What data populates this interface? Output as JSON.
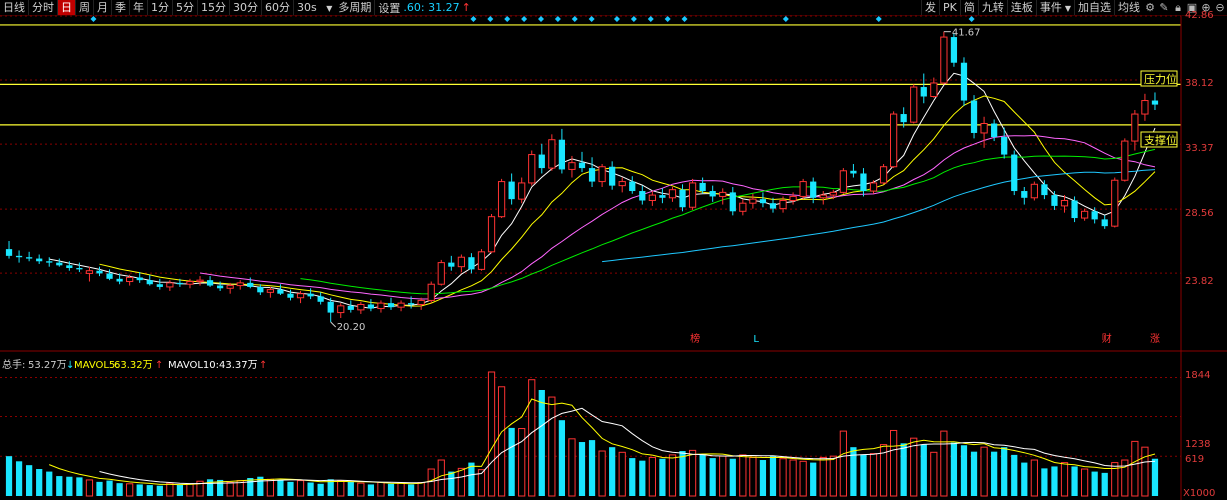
{
  "toolbar": {
    "items": [
      {
        "label": "日线",
        "active": false
      },
      {
        "label": "分时",
        "active": false
      },
      {
        "label": "日",
        "active": true
      },
      {
        "label": "周",
        "active": false
      },
      {
        "label": "月",
        "active": false
      },
      {
        "label": "季",
        "active": false
      },
      {
        "label": "年",
        "active": false
      },
      {
        "label": "1分",
        "active": false
      },
      {
        "label": "5分",
        "active": false
      },
      {
        "label": "15分",
        "active": false
      },
      {
        "label": "30分",
        "active": false
      },
      {
        "label": "60分",
        "active": false
      }
    ],
    "dropdown": "30s",
    "dropdown_arrow": "▼",
    "multi_period": "多周期",
    "settings": "设置",
    "readout": ".60: 31.27",
    "readout_arrow": "↑",
    "right_items": [
      "发",
      "PK",
      "简",
      "九转",
      "连板",
      "事件"
    ],
    "right_menu_arrow": "▼",
    "right_items2": [
      "加自选",
      "均线"
    ],
    "icons": [
      "gear-icon",
      "paint-icon",
      "lock-icon",
      "image-icon",
      "zoom-in-icon",
      "zoom-out-icon"
    ]
  },
  "colors": {
    "up": "#ff3333",
    "down": "#19e6ff",
    "ma5": "#ffffff",
    "ma10": "#ffff00",
    "ma20": "#ff66ff",
    "ma30": "#00ee00",
    "ma60": "#1fc8ff",
    "level_line": "#ffff33",
    "grid": "#8a0000",
    "axis_text": "#e23b3b"
  },
  "price_axis": {
    "labels": [
      "42.86",
      "38.12",
      "33.37",
      "28.56",
      "23.82"
    ],
    "ymin": 18.5,
    "ymax": 42.86
  },
  "level_labels": {
    "resistance": "压力位",
    "support": "支撑位"
  },
  "annotations": {
    "high": "41.67",
    "low": "20.20",
    "events": [
      "榜",
      "L",
      "财",
      "涨"
    ]
  },
  "volume_panel": {
    "legend_total_label": "总手:",
    "legend_total_value": "53.27万",
    "legend_total_arrow": "↓",
    "legend_mavol5_label": "MAVOL5:",
    "legend_mavol5_value": "63.32万",
    "legend_mavol5_arrow": "↑",
    "legend_mavol10_label": "MAVOL10:",
    "legend_mavol10_value": "43.37万",
    "legend_mavol10_arrow": "↑",
    "axis_labels": [
      "1844",
      "1238",
      "619"
    ],
    "unit": "X1000",
    "vmax": 1930
  },
  "chart_data": {
    "type": "candlestick",
    "ohlc": [
      [
        25.6,
        26.2,
        24.9,
        25.1
      ],
      [
        25.1,
        25.5,
        24.6,
        25.0
      ],
      [
        25.0,
        25.4,
        24.7,
        24.9
      ],
      [
        24.9,
        25.2,
        24.5,
        24.7
      ],
      [
        24.7,
        25.0,
        24.3,
        24.6
      ],
      [
        24.6,
        24.9,
        24.3,
        24.4
      ],
      [
        24.4,
        24.7,
        24.0,
        24.2
      ],
      [
        24.2,
        24.6,
        23.9,
        24.1
      ],
      [
        23.8,
        24.3,
        23.2,
        24.0
      ],
      [
        24.0,
        24.3,
        23.6,
        23.8
      ],
      [
        23.8,
        24.1,
        23.3,
        23.4
      ],
      [
        23.4,
        23.8,
        23.0,
        23.2
      ],
      [
        23.2,
        23.7,
        22.9,
        23.5
      ],
      [
        23.5,
        23.9,
        23.1,
        23.3
      ],
      [
        23.3,
        23.7,
        22.9,
        23.0
      ],
      [
        23.0,
        23.4,
        22.6,
        22.8
      ],
      [
        22.8,
        23.3,
        22.5,
        23.1
      ],
      [
        23.1,
        23.4,
        22.8,
        23.0
      ],
      [
        23.0,
        23.4,
        22.7,
        23.2
      ],
      [
        23.2,
        23.6,
        22.9,
        23.3
      ],
      [
        23.3,
        23.6,
        22.8,
        22.9
      ],
      [
        22.9,
        23.2,
        22.5,
        22.7
      ],
      [
        22.7,
        23.1,
        22.3,
        22.9
      ],
      [
        22.9,
        23.3,
        22.6,
        23.1
      ],
      [
        23.1,
        23.5,
        22.7,
        22.8
      ],
      [
        22.8,
        23.0,
        22.2,
        22.4
      ],
      [
        22.4,
        22.8,
        22.0,
        22.6
      ],
      [
        22.6,
        23.0,
        22.2,
        22.3
      ],
      [
        22.3,
        22.6,
        21.8,
        22.0
      ],
      [
        22.0,
        22.5,
        21.6,
        22.3
      ],
      [
        22.3,
        22.7,
        21.9,
        22.1
      ],
      [
        22.1,
        22.4,
        21.5,
        21.7
      ],
      [
        21.7,
        22.0,
        20.2,
        20.9
      ],
      [
        20.9,
        21.6,
        20.5,
        21.4
      ],
      [
        21.4,
        21.8,
        20.9,
        21.1
      ],
      [
        21.1,
        21.7,
        20.8,
        21.5
      ],
      [
        21.5,
        21.9,
        21.0,
        21.2
      ],
      [
        21.2,
        21.8,
        20.9,
        21.6
      ],
      [
        21.6,
        22.0,
        21.1,
        21.3
      ],
      [
        21.3,
        21.8,
        21.0,
        21.6
      ],
      [
        21.6,
        22.1,
        21.2,
        21.5
      ],
      [
        21.5,
        22.0,
        21.1,
        21.8
      ],
      [
        21.8,
        23.2,
        21.6,
        23.0
      ],
      [
        23.0,
        24.8,
        22.9,
        24.6
      ],
      [
        24.6,
        25.1,
        24.0,
        24.3
      ],
      [
        24.3,
        25.2,
        23.9,
        25.0
      ],
      [
        25.0,
        25.3,
        23.8,
        24.1
      ],
      [
        24.1,
        25.6,
        24.0,
        25.4
      ],
      [
        25.4,
        28.2,
        25.3,
        28.0
      ],
      [
        28.0,
        30.8,
        27.9,
        30.6
      ],
      [
        30.6,
        31.2,
        28.9,
        29.3
      ],
      [
        29.3,
        30.9,
        29.0,
        30.5
      ],
      [
        30.5,
        32.9,
        30.3,
        32.6
      ],
      [
        32.6,
        33.4,
        31.2,
        31.6
      ],
      [
        31.6,
        34.1,
        31.4,
        33.7
      ],
      [
        33.7,
        34.5,
        31.2,
        31.5
      ],
      [
        31.5,
        32.5,
        30.9,
        32.0
      ],
      [
        32.0,
        32.8,
        31.3,
        31.6
      ],
      [
        31.6,
        32.4,
        30.2,
        30.6
      ],
      [
        30.6,
        31.9,
        30.2,
        31.7
      ],
      [
        31.7,
        32.1,
        30.0,
        30.3
      ],
      [
        30.3,
        30.9,
        29.8,
        30.6
      ],
      [
        30.6,
        31.0,
        29.7,
        29.9
      ],
      [
        29.9,
        30.3,
        28.9,
        29.2
      ],
      [
        29.2,
        29.9,
        28.8,
        29.6
      ],
      [
        29.6,
        30.1,
        29.0,
        29.4
      ],
      [
        29.4,
        30.2,
        29.1,
        30.0
      ],
      [
        30.0,
        30.4,
        28.4,
        28.7
      ],
      [
        28.7,
        30.8,
        28.5,
        30.5
      ],
      [
        30.5,
        30.9,
        29.7,
        29.9
      ],
      [
        29.9,
        30.3,
        29.1,
        29.5
      ],
      [
        29.5,
        30.1,
        28.9,
        29.8
      ],
      [
        29.8,
        30.2,
        28.1,
        28.4
      ],
      [
        28.4,
        29.3,
        28.1,
        29.0
      ],
      [
        29.0,
        29.7,
        28.6,
        29.3
      ],
      [
        29.3,
        29.8,
        28.7,
        29.0
      ],
      [
        29.0,
        29.4,
        28.3,
        28.6
      ],
      [
        28.6,
        29.5,
        28.3,
        29.2
      ],
      [
        29.2,
        29.8,
        28.9,
        29.5
      ],
      [
        29.5,
        30.8,
        29.3,
        30.6
      ],
      [
        30.6,
        30.9,
        29.0,
        29.4
      ],
      [
        29.4,
        29.9,
        28.9,
        29.6
      ],
      [
        29.6,
        30.0,
        29.3,
        29.8
      ],
      [
        29.8,
        31.6,
        29.7,
        31.4
      ],
      [
        31.4,
        31.9,
        30.9,
        31.2
      ],
      [
        31.2,
        31.6,
        29.5,
        29.9
      ],
      [
        29.9,
        30.7,
        29.7,
        30.5
      ],
      [
        30.5,
        31.9,
        30.4,
        31.7
      ],
      [
        31.7,
        35.8,
        31.6,
        35.6
      ],
      [
        35.6,
        36.1,
        34.6,
        35.0
      ],
      [
        35.0,
        37.8,
        34.9,
        37.6
      ],
      [
        37.6,
        38.6,
        36.4,
        36.9
      ],
      [
        36.9,
        38.3,
        36.8,
        37.9
      ],
      [
        37.9,
        41.7,
        37.8,
        41.3
      ],
      [
        41.3,
        41.6,
        39.1,
        39.4
      ],
      [
        39.4,
        39.8,
        36.2,
        36.6
      ],
      [
        36.6,
        37.0,
        33.8,
        34.2
      ],
      [
        34.2,
        35.4,
        33.1,
        34.9
      ],
      [
        34.9,
        35.2,
        33.6,
        33.9
      ],
      [
        33.9,
        34.6,
        32.3,
        32.6
      ],
      [
        32.6,
        32.9,
        29.6,
        29.9
      ],
      [
        29.9,
        30.2,
        28.9,
        29.4
      ],
      [
        29.4,
        30.6,
        29.2,
        30.4
      ],
      [
        30.4,
        30.7,
        29.3,
        29.6
      ],
      [
        29.6,
        29.9,
        28.5,
        28.8
      ],
      [
        28.8,
        29.6,
        28.3,
        29.2
      ],
      [
        29.2,
        29.5,
        27.6,
        27.9
      ],
      [
        27.9,
        28.6,
        27.7,
        28.4
      ],
      [
        28.4,
        28.7,
        27.5,
        27.8
      ],
      [
        27.8,
        28.1,
        27.1,
        27.3
      ],
      [
        27.3,
        30.9,
        27.2,
        30.7
      ],
      [
        30.7,
        33.8,
        30.6,
        33.6
      ],
      [
        33.6,
        35.9,
        32.9,
        35.6
      ],
      [
        35.6,
        37.1,
        35.1,
        36.6
      ],
      [
        36.6,
        37.2,
        35.9,
        36.3
      ]
    ],
    "volume": [
      [
        620,
        "down"
      ],
      [
        540,
        "down"
      ],
      [
        480,
        "down"
      ],
      [
        420,
        "down"
      ],
      [
        380,
        "down"
      ],
      [
        310,
        "down"
      ],
      [
        300,
        "down"
      ],
      [
        290,
        "down"
      ],
      [
        250,
        "up"
      ],
      [
        220,
        "down"
      ],
      [
        240,
        "down"
      ],
      [
        200,
        "down"
      ],
      [
        190,
        "up"
      ],
      [
        180,
        "down"
      ],
      [
        170,
        "down"
      ],
      [
        160,
        "down"
      ],
      [
        200,
        "up"
      ],
      [
        180,
        "down"
      ],
      [
        190,
        "up"
      ],
      [
        230,
        "up"
      ],
      [
        260,
        "down"
      ],
      [
        250,
        "down"
      ],
      [
        210,
        "up"
      ],
      [
        240,
        "up"
      ],
      [
        280,
        "down"
      ],
      [
        300,
        "down"
      ],
      [
        260,
        "up"
      ],
      [
        250,
        "down"
      ],
      [
        220,
        "down"
      ],
      [
        240,
        "up"
      ],
      [
        210,
        "down"
      ],
      [
        190,
        "down"
      ],
      [
        260,
        "down"
      ],
      [
        240,
        "up"
      ],
      [
        220,
        "down"
      ],
      [
        200,
        "up"
      ],
      [
        180,
        "down"
      ],
      [
        210,
        "up"
      ],
      [
        190,
        "down"
      ],
      [
        200,
        "up"
      ],
      [
        180,
        "down"
      ],
      [
        210,
        "up"
      ],
      [
        420,
        "up"
      ],
      [
        560,
        "up"
      ],
      [
        380,
        "down"
      ],
      [
        430,
        "up"
      ],
      [
        520,
        "down"
      ],
      [
        410,
        "up"
      ],
      [
        1930,
        "up"
      ],
      [
        1700,
        "up"
      ],
      [
        1060,
        "down"
      ],
      [
        1050,
        "up"
      ],
      [
        1810,
        "up"
      ],
      [
        1650,
        "down"
      ],
      [
        1540,
        "up"
      ],
      [
        1180,
        "down"
      ],
      [
        890,
        "up"
      ],
      [
        840,
        "down"
      ],
      [
        870,
        "down"
      ],
      [
        700,
        "up"
      ],
      [
        760,
        "down"
      ],
      [
        680,
        "up"
      ],
      [
        590,
        "down"
      ],
      [
        550,
        "down"
      ],
      [
        600,
        "up"
      ],
      [
        580,
        "down"
      ],
      [
        640,
        "up"
      ],
      [
        700,
        "down"
      ],
      [
        710,
        "up"
      ],
      [
        640,
        "down"
      ],
      [
        590,
        "down"
      ],
      [
        620,
        "up"
      ],
      [
        580,
        "down"
      ],
      [
        640,
        "up"
      ],
      [
        600,
        "up"
      ],
      [
        560,
        "down"
      ],
      [
        620,
        "down"
      ],
      [
        580,
        "up"
      ],
      [
        560,
        "up"
      ],
      [
        540,
        "up"
      ],
      [
        520,
        "down"
      ],
      [
        600,
        "up"
      ],
      [
        620,
        "up"
      ],
      [
        1010,
        "up"
      ],
      [
        760,
        "down"
      ],
      [
        640,
        "down"
      ],
      [
        660,
        "up"
      ],
      [
        800,
        "up"
      ],
      [
        1020,
        "up"
      ],
      [
        820,
        "down"
      ],
      [
        900,
        "up"
      ],
      [
        800,
        "down"
      ],
      [
        680,
        "up"
      ],
      [
        1010,
        "up"
      ],
      [
        830,
        "down"
      ],
      [
        790,
        "down"
      ],
      [
        690,
        "down"
      ],
      [
        760,
        "up"
      ],
      [
        690,
        "down"
      ],
      [
        760,
        "down"
      ],
      [
        640,
        "down"
      ],
      [
        520,
        "down"
      ],
      [
        560,
        "up"
      ],
      [
        430,
        "down"
      ],
      [
        460,
        "down"
      ],
      [
        520,
        "up"
      ],
      [
        460,
        "down"
      ],
      [
        420,
        "up"
      ],
      [
        380,
        "down"
      ],
      [
        360,
        "down"
      ],
      [
        520,
        "up"
      ],
      [
        560,
        "up"
      ],
      [
        850,
        "up"
      ],
      [
        760,
        "up"
      ],
      [
        580,
        "down"
      ]
    ],
    "xlabel": "",
    "ylabel": "",
    "ylim": [
      18.5,
      42.86
    ],
    "moving_averages": [
      "MA5",
      "MA10",
      "MA20",
      "MA30",
      "MA60"
    ],
    "levels": {
      "top": 42.2,
      "resistance": 37.8,
      "support": 34.8
    },
    "event_markers": [
      {
        "index": 65,
        "label": "榜"
      },
      {
        "index": 71,
        "label": "L"
      },
      {
        "index": 104,
        "label": "财"
      },
      {
        "index": 114,
        "label": "涨"
      }
    ]
  }
}
